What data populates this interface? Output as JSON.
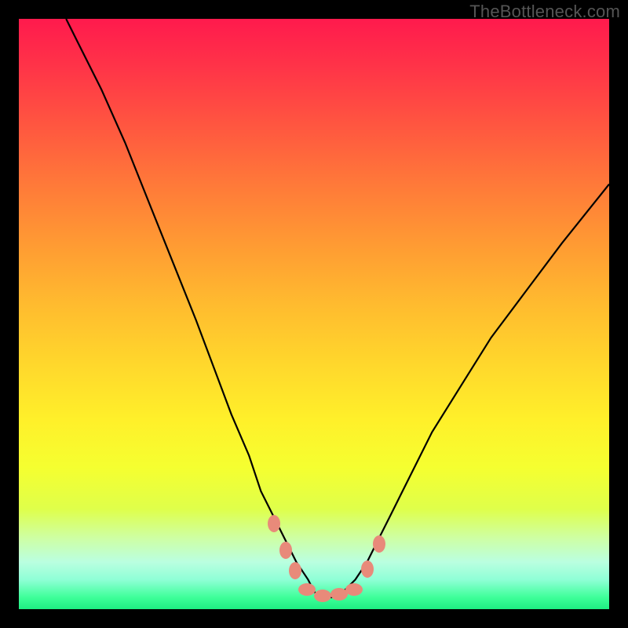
{
  "watermark": "TheBottleneck.com",
  "chart_data": {
    "type": "line",
    "title": "",
    "xlabel": "",
    "ylabel": "",
    "xlim": [
      0,
      100
    ],
    "ylim": [
      0,
      100
    ],
    "series": [
      {
        "name": "curve",
        "x": [
          8,
          10,
          14,
          18,
          22,
          26,
          30,
          33,
          36,
          39,
          41,
          43,
          45,
          47,
          49,
          50,
          51,
          52,
          53,
          55,
          57,
          59,
          61,
          63,
          66,
          70,
          75,
          80,
          86,
          92,
          100
        ],
        "y": [
          100,
          96,
          88,
          79,
          69,
          59,
          49,
          41,
          33,
          26,
          20,
          16,
          12,
          8,
          5,
          3,
          2,
          2,
          2,
          3,
          5,
          8,
          12,
          16,
          22,
          30,
          38,
          46,
          54,
          62,
          72
        ]
      }
    ],
    "markers": [
      {
        "x": 43.2,
        "y": 14.5,
        "shape": "v"
      },
      {
        "x": 45.2,
        "y": 10.0,
        "shape": "v"
      },
      {
        "x": 46.8,
        "y": 6.5,
        "shape": "v"
      },
      {
        "x": 48.8,
        "y": 3.3,
        "shape": "h"
      },
      {
        "x": 51.5,
        "y": 2.3,
        "shape": "h"
      },
      {
        "x": 54.3,
        "y": 2.5,
        "shape": "h"
      },
      {
        "x": 56.8,
        "y": 3.3,
        "shape": "h"
      },
      {
        "x": 59.0,
        "y": 6.8,
        "shape": "v"
      },
      {
        "x": 61.0,
        "y": 11.0,
        "shape": "v"
      }
    ]
  }
}
